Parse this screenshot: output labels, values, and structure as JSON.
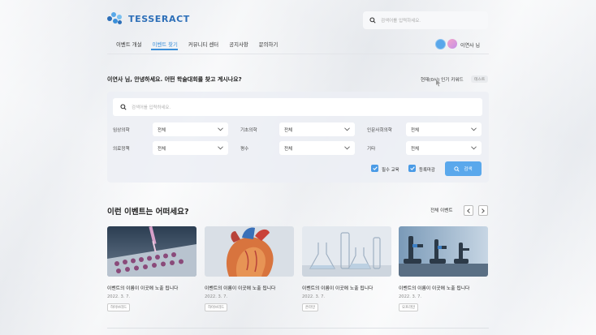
{
  "header": {
    "logo_text": "TESSERACT",
    "search_placeholder": "검색어를 입력하세요.",
    "nav": [
      "이벤트 개설",
      "이벤트 찾기",
      "커뮤니티 센터",
      "공지사항",
      "문의하기"
    ],
    "active_nav": "이벤트 찾기",
    "username": "이연사 님",
    "accent_color": "#3b8fd9"
  },
  "greeting": "이연사 님, 안녕하세요. 어떤 학술대회를 찾고 계시나요?",
  "popular": {
    "label": "현재(0시) 인기 키워드",
    "tag": "테스트"
  },
  "search_panel": {
    "placeholder": "검색어를 입력하세요.",
    "filters": [
      {
        "label": "임상의학",
        "value": "전체"
      },
      {
        "label": "기초의학",
        "value": "전체"
      },
      {
        "label": "인문사회의학",
        "value": "전체"
      },
      {
        "label": "의료정책",
        "value": "전체"
      },
      {
        "label": "평수",
        "value": "전체"
      },
      {
        "label": "기타",
        "value": "전체"
      }
    ],
    "checkboxes": [
      {
        "label": "필수 교육",
        "checked": true
      },
      {
        "label": "등록마감",
        "checked": true
      }
    ],
    "search_button": "검색"
  },
  "events": {
    "section_title": "이런 이벤트는 어떠세요?",
    "all_link": "전체 이벤트",
    "cards": [
      {
        "title": "이벤트의 이름이 이곳에 노출 됩니다",
        "date": "2022. 3. 7.",
        "tag": "하이브리드",
        "image": "lab-pipette-plate"
      },
      {
        "title": "이벤트의 이름이 이곳에 노출 됩니다",
        "date": "2022. 3. 7.",
        "tag": "하이브리드",
        "image": "heart-model"
      },
      {
        "title": "이벤트의 이름이 이곳에 노출 됩니다",
        "date": "2022. 3. 7.",
        "tag": "온라인",
        "image": "lab-glassware"
      },
      {
        "title": "이벤트의 이름이 이곳에 노출 됩니다",
        "date": "2022. 3. 7.",
        "tag": "오프라인",
        "image": "microscopes"
      }
    ]
  }
}
